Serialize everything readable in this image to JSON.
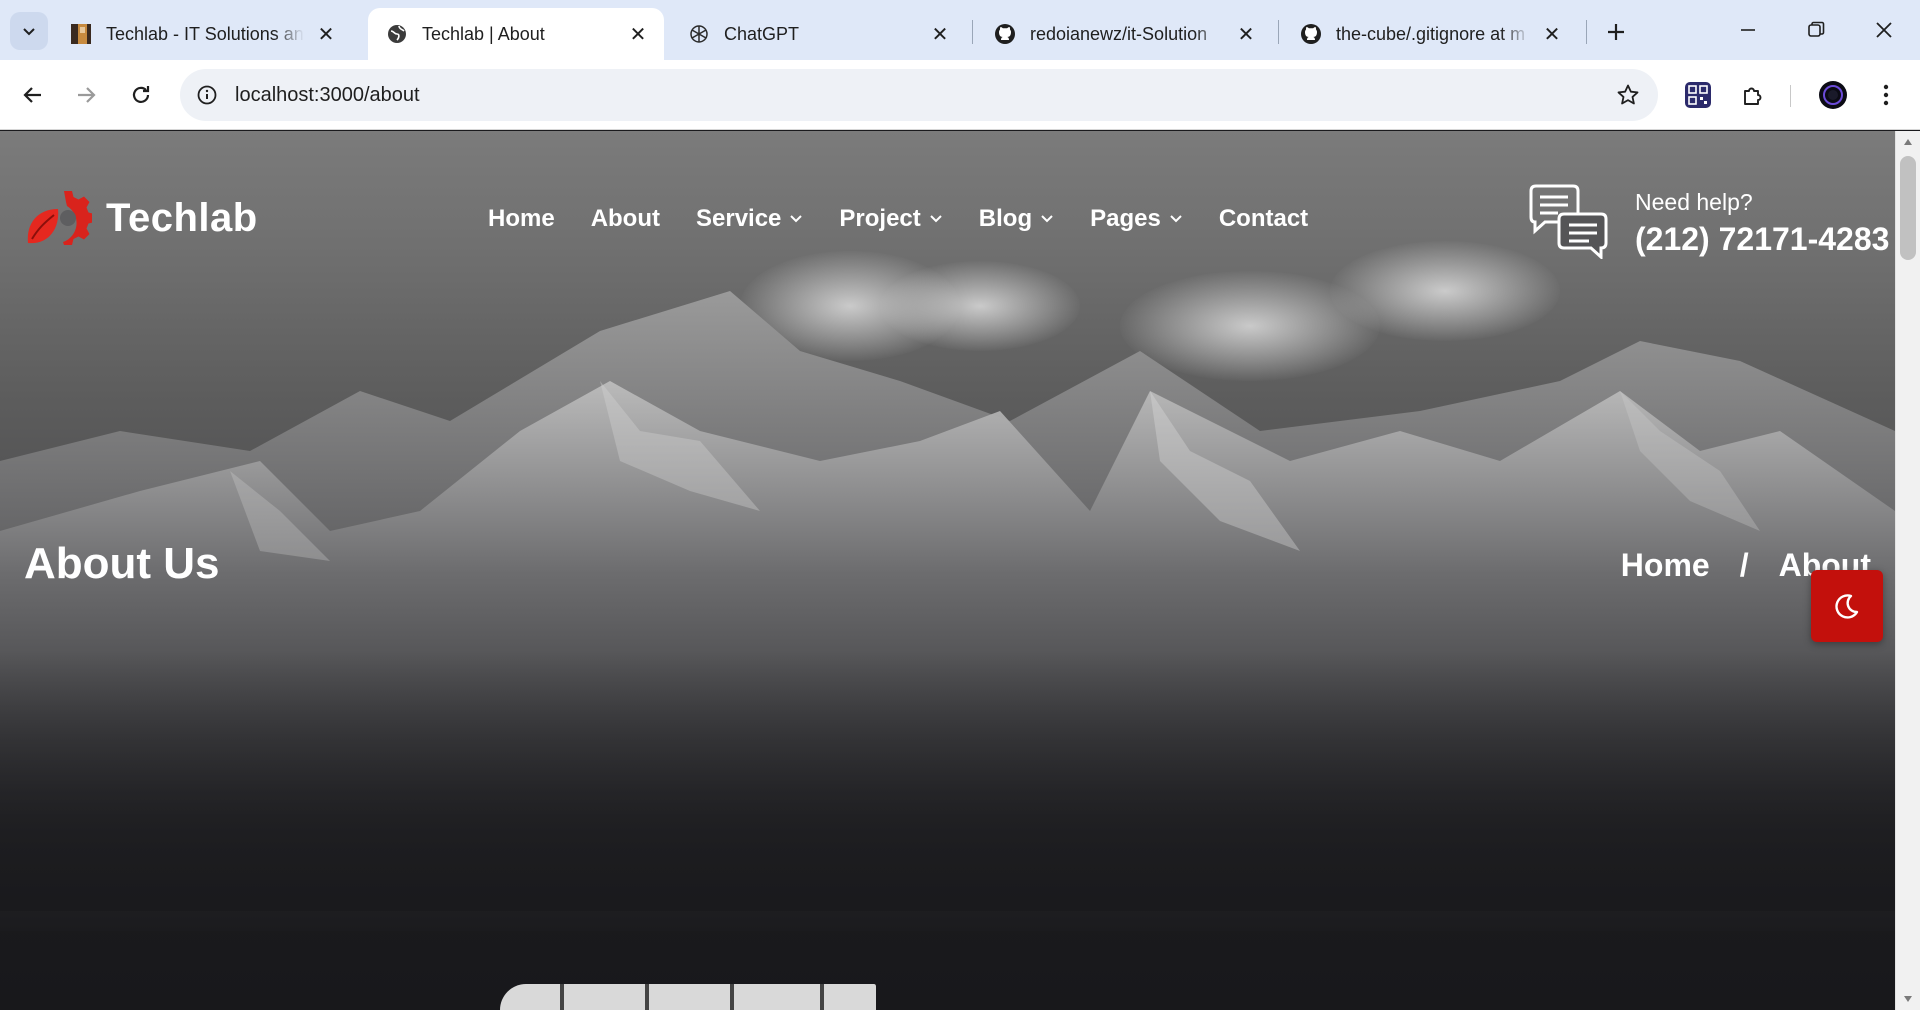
{
  "browser": {
    "tabs": [
      {
        "title": "Techlab - IT Solutions and",
        "favicon": "site-thumbnail-icon"
      },
      {
        "title": "Techlab | About",
        "favicon": "globe-icon"
      },
      {
        "title": "ChatGPT",
        "favicon": "chatgpt-icon"
      },
      {
        "title": "redoianewz/it-Solution",
        "favicon": "github-icon"
      },
      {
        "title": "the-cube/.gitignore at m",
        "favicon": "github-icon"
      }
    ],
    "active_tab": 1,
    "url": "localhost:3000/about"
  },
  "site": {
    "logo_text": "Techlab",
    "nav": [
      {
        "label": "Home",
        "has_dropdown": false
      },
      {
        "label": "About",
        "has_dropdown": false
      },
      {
        "label": "Service",
        "has_dropdown": true
      },
      {
        "label": "Project",
        "has_dropdown": true
      },
      {
        "label": "Blog",
        "has_dropdown": true
      },
      {
        "label": "Pages",
        "has_dropdown": true
      },
      {
        "label": "Contact",
        "has_dropdown": false
      }
    ],
    "help": {
      "label": "Need help?",
      "phone": "(212) 72171-4283"
    }
  },
  "hero": {
    "title": "About Us",
    "breadcrumb": {
      "home": "Home",
      "separator": "/",
      "current": "About"
    }
  },
  "colors": {
    "accent": "#c3100c",
    "logo_red": "#d9231c",
    "tabstrip": "#dfe8f8"
  },
  "icons": {
    "theme_toggle": "moon-icon",
    "help": "chat-bubbles-icon"
  }
}
